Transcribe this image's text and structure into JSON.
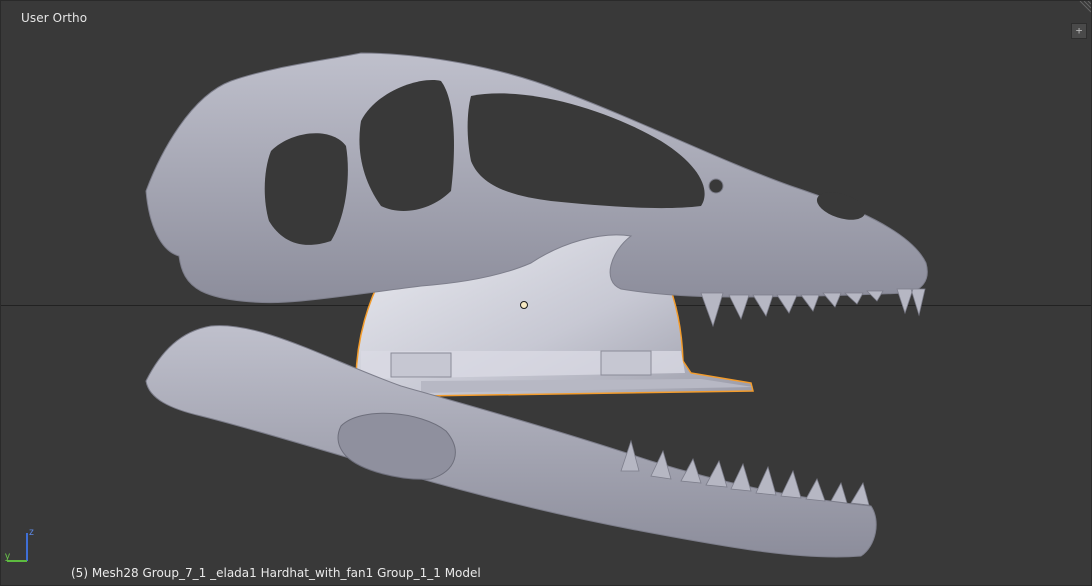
{
  "viewport": {
    "view_label": "User Ortho",
    "status_text": "(5) Mesh28 Group_7_1 _elada1 Hardhat_with_fan1 Group_1_1 Model",
    "background_color": "#393939",
    "selection_outline_color": "#f39c2c",
    "mesh_color": "#a9aab6"
  },
  "navigation": {
    "expand_button_label": "+",
    "axis_labels": {
      "x": "",
      "y": "y",
      "z": "z"
    }
  },
  "scene": {
    "objects": [
      "dinosaur-skull",
      "hardhat-selected"
    ],
    "grid_horizon": true
  }
}
